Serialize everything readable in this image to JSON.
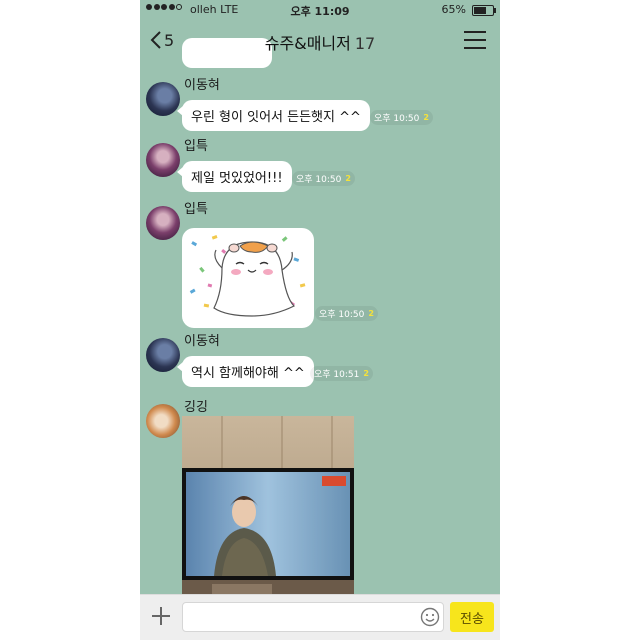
{
  "status_bar": {
    "carrier": "olleh  LTE",
    "time": "오후 11:09",
    "battery": "65%",
    "battery_level": 0.65
  },
  "header": {
    "back_count": "5",
    "title": "슈주&매니저",
    "member_count": "17"
  },
  "messages": [
    {
      "sender": "이동혀",
      "text": "우린 형이 잇어서 든든햇지 ^^",
      "time": "오후 10:50",
      "unread": "2"
    },
    {
      "sender": "입특",
      "text": "제일 멋있었어!!!",
      "time": "오후 10:50",
      "unread": "2"
    },
    {
      "sender": "입특",
      "type": "sticker",
      "time": "오후 10:50",
      "unread": "2"
    },
    {
      "sender": "이동혀",
      "text": "역시 함께해야해 ^^",
      "time": "오후 10:51",
      "unread": "2"
    },
    {
      "sender": "깅깅",
      "type": "photo"
    }
  ],
  "input": {
    "placeholder": "",
    "send_label": "전송"
  },
  "icons": {
    "back": "chevron-left-icon",
    "menu": "hamburger-menu-icon",
    "attach": "plus-icon",
    "emoticon": "smiley-icon"
  },
  "colors": {
    "chat_background": "#9bc2b0",
    "send_button": "#f7e51c",
    "unread": "#f5e23a"
  }
}
